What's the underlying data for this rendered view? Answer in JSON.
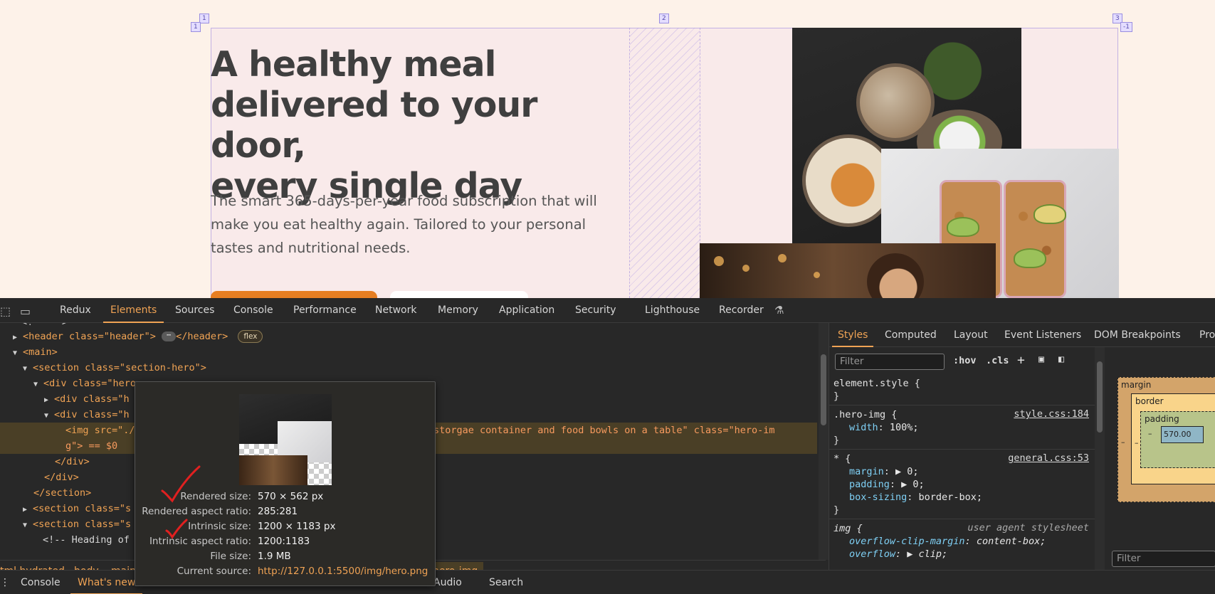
{
  "hero": {
    "title_lines": [
      "A healthy meal",
      "delivered to your door,",
      "every single day"
    ],
    "description": "The smart 365-days-per-year food subscription that will make you eat healthy again. Tailored to your personal tastes and nutritional needs.",
    "grid_labels": {
      "top_left": "1",
      "left": "1",
      "mid": "2",
      "right": "3",
      "right_neg": "-1"
    }
  },
  "devtools": {
    "tabs": [
      "Redux",
      "Elements",
      "Sources",
      "Console",
      "Performance",
      "Network",
      "Memory",
      "Application",
      "Security",
      "Lighthouse",
      "Recorder"
    ],
    "active_tab": "Elements",
    "dom": {
      "comment": "<!-- -->",
      "header_tag": "<header class=\"header\">",
      "header_close": "</header>",
      "header_badge": "flex",
      "main": "<main>",
      "section_hero": "<section class=\"section-hero\">",
      "div_hero": "<div class=\"hero",
      "div_hero_text": "<div class=\"h",
      "div_hero_img": "<div class=\"h",
      "img_start": "<img src=\"./",
      "img_alt_tail": "storgae container and food bowls on a table\" class=\"hero-im",
      "img_line2": "g\"> == $0",
      "div_close": "</div>",
      "div_close2": "</div>",
      "section_close": "</section>",
      "section_s1": "<section class=\"s",
      "section_s2": "<section class=\"s",
      "comment2": "<!-- Heading of"
    },
    "breadcrumb": [
      "tml.hydrated",
      "body",
      "main",
      "hero-img"
    ],
    "drawer_tabs": [
      "Console",
      "What's new",
      "Audio",
      "Search"
    ],
    "drawer_active": "What's new",
    "styles": {
      "tabs": [
        "Styles",
        "Computed",
        "Layout",
        "Event Listeners",
        "DOM Breakpoints",
        "Pro"
      ],
      "active_tab": "Styles",
      "filter_placeholder": "Filter",
      "hov": ":hov",
      "cls": ".cls",
      "rules": [
        {
          "selector": "element.style {",
          "close": "}"
        },
        {
          "selector": ".hero-img {",
          "source": "style.css:184",
          "props": [
            {
              "name": "width",
              "value": "100%;"
            }
          ],
          "close": "}"
        },
        {
          "selector": "* {",
          "source": "general.css:53",
          "props": [
            {
              "name": "margin",
              "value": "▶ 0;"
            },
            {
              "name": "padding",
              "value": "▶ 0;"
            },
            {
              "name": "box-sizing",
              "value": "border-box;"
            }
          ],
          "close": "}"
        },
        {
          "selector": "img {",
          "source": "user agent stylesheet",
          "props": [
            {
              "name": "overflow-clip-margin",
              "value": "content-box;"
            },
            {
              "name": "overflow",
              "value": "▶ clip;"
            }
          ]
        }
      ],
      "box_model": {
        "margin": "margin",
        "border": "border",
        "padding": "padding",
        "content": "570.00",
        "dash": "–"
      },
      "box_filter_placeholder": "Filter"
    },
    "tooltip": {
      "rows": [
        {
          "key": "Rendered size:",
          "value": "570 × 562 px"
        },
        {
          "key": "Rendered aspect ratio:",
          "value": "285:281"
        },
        {
          "key": "Intrinsic size:",
          "value": "1200 × 1183 px"
        },
        {
          "key": "Intrinsic aspect ratio:",
          "value": "1200:1183"
        },
        {
          "key": "File size:",
          "value": "1.9 MB"
        },
        {
          "key": "Current source:",
          "value": "http://127.0.0.1:5500/img/hero.png"
        }
      ]
    }
  },
  "colors": {
    "accent": "#f0a354",
    "page_bg": "#fdf2e9",
    "hero_bg": "#f9eaea",
    "cta": "#e67e22"
  }
}
